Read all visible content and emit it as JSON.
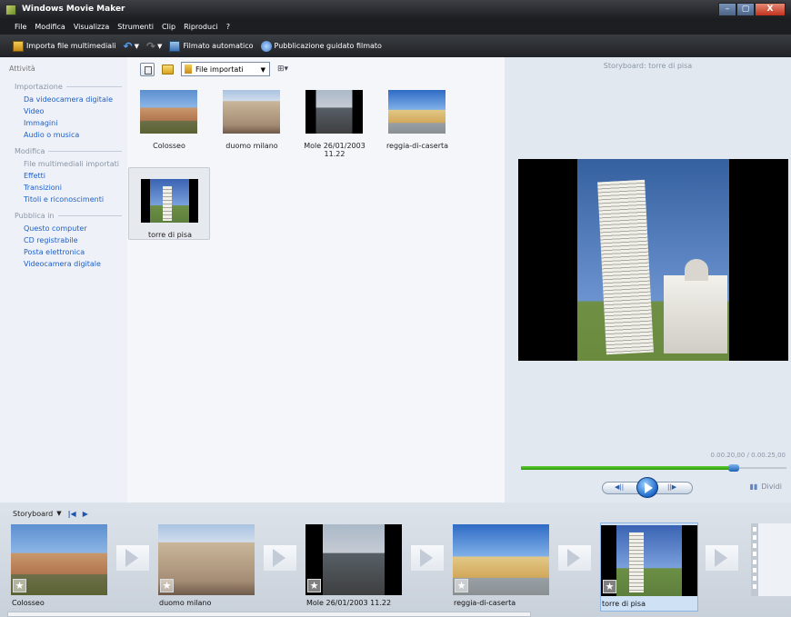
{
  "window": {
    "title": "Windows Movie Maker",
    "min": "–",
    "max": "▢",
    "close": "X"
  },
  "menu": [
    "File",
    "Modifica",
    "Visualizza",
    "Strumenti",
    "Clip",
    "Riproduci",
    "?"
  ],
  "toolbar": {
    "import_label": "Importa file multimediali",
    "auto_label": "Filmato automatico",
    "publish_label": "Pubblicazione guidato filmato"
  },
  "tasks": {
    "header": "Attività",
    "import": {
      "title": "Importazione",
      "items": [
        "Da videocamera digitale",
        "Video",
        "Immagini",
        "Audio o musica"
      ]
    },
    "edit": {
      "title": "Modifica",
      "items": [
        "File multimediali importati",
        "Effetti",
        "Transizioni",
        "Titoli e riconoscimenti"
      ]
    },
    "publish": {
      "title": "Pubblica in",
      "items": [
        "Questo computer",
        "CD registrabile",
        "Posta elettronica",
        "Videocamera digitale"
      ]
    }
  },
  "collection": {
    "selector": "File importati",
    "clips": [
      "Colosseo",
      "duomo milano",
      "Mole 26/01/2003 11.22",
      "reggia-di-caserta",
      "torre di pisa"
    ]
  },
  "preview": {
    "title": "Storyboard: torre di pisa",
    "time": "0.00.20,00 / 0.00.25,00",
    "progress": 0.8,
    "split_label": "Dividi"
  },
  "storyboard": {
    "label": "Storyboard",
    "items": [
      "Colosseo",
      "duomo milano",
      "Mole 26/01/2003 11.22",
      "reggia-di-caserta",
      "torre di pisa"
    ]
  }
}
